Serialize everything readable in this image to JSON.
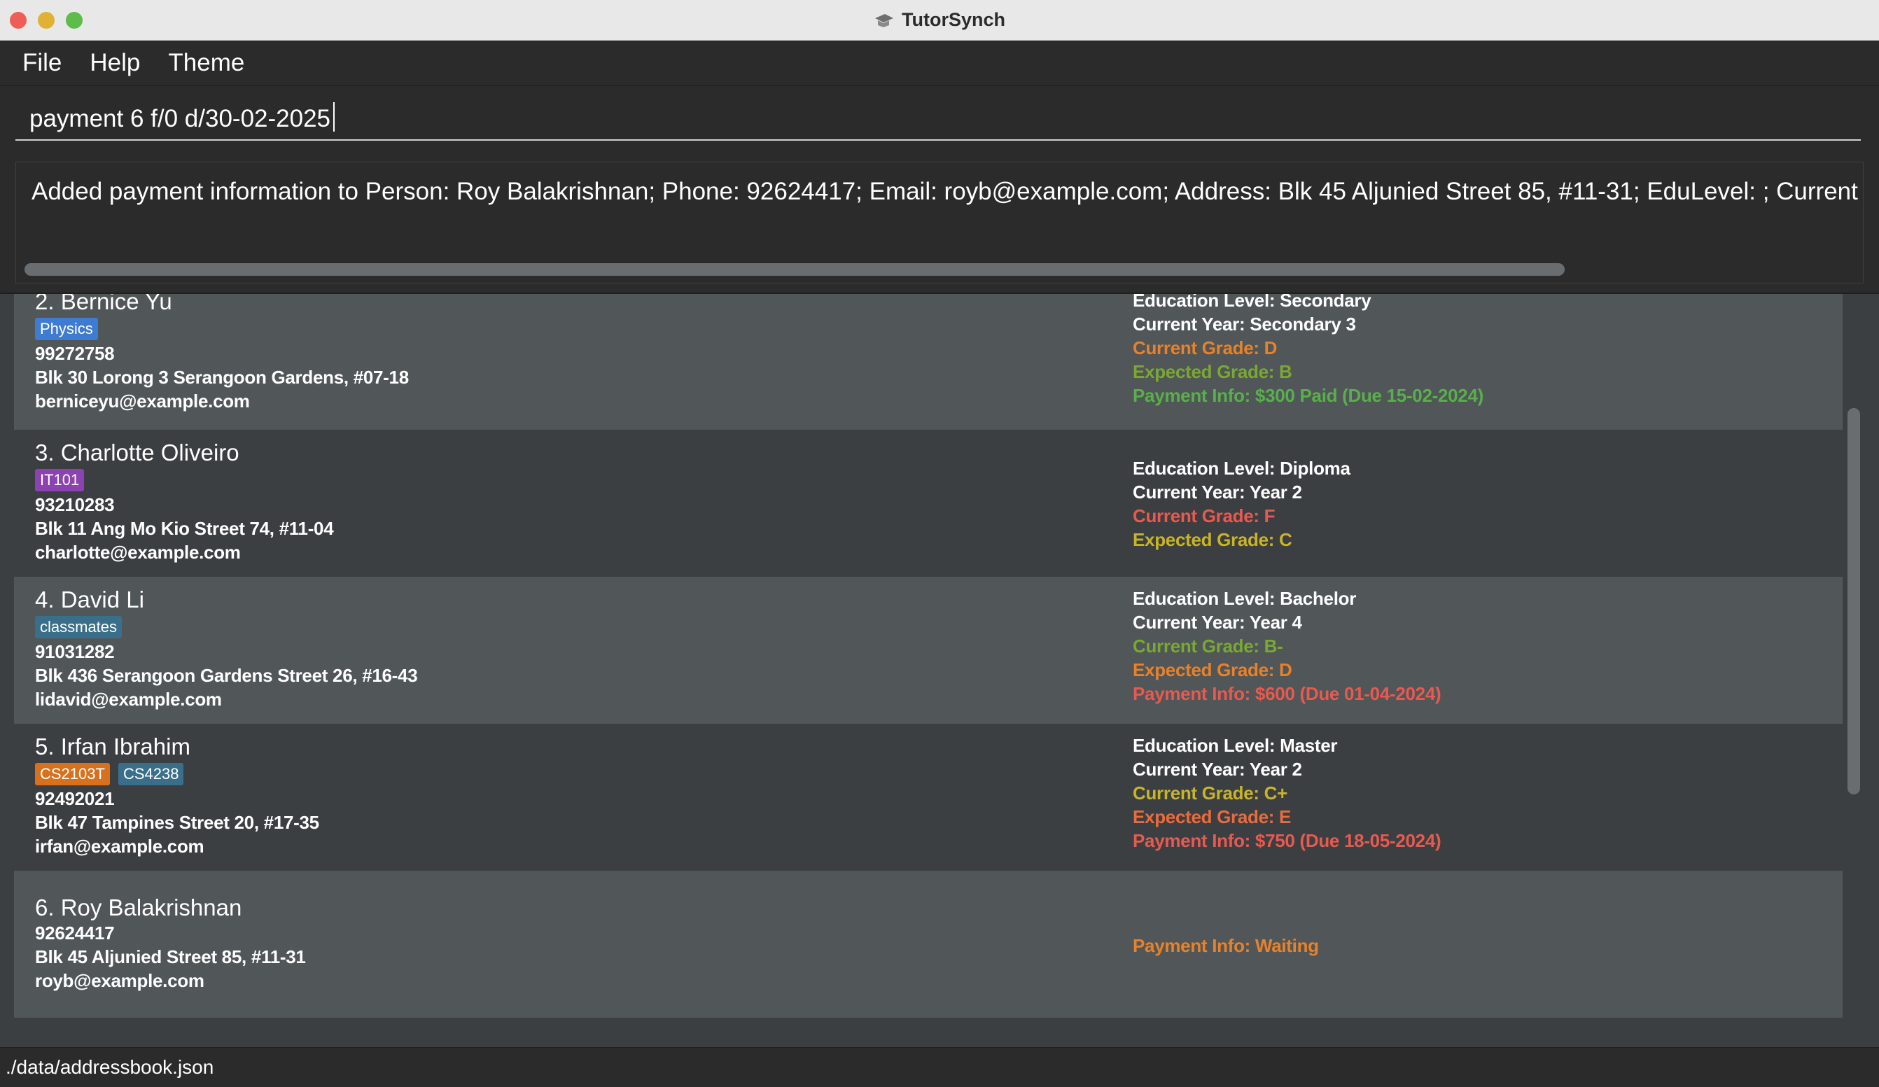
{
  "window": {
    "title": "TutorSynch"
  },
  "menu": {
    "items": [
      "File",
      "Help",
      "Theme"
    ]
  },
  "command": {
    "value": "payment 6 f/0 d/30-02-2025"
  },
  "result": {
    "text": "Added payment information to Person: Roy Balakrishnan; Phone: 92624417; Email: royb@example.com; Address: Blk 45 Aljunied Street 85, #11-31; EduLevel: ; Current Year: ; Current"
  },
  "persons": [
    {
      "name": "2. Bernice Yu",
      "tags": [
        {
          "label": "Physics",
          "color": "#3e7bd3"
        }
      ],
      "phone": "99272758",
      "address": "Blk 30 Lorong 3 Serangoon Gardens, #07-18",
      "email": "berniceyu@example.com",
      "education": "Education Level: Secondary",
      "year": "Current Year: Secondary 3",
      "current_grade": "Current Grade: D",
      "current_grade_color": "#e8822a",
      "expected_grade": "Expected Grade: B",
      "expected_grade_color": "#7aa832",
      "payment": "Payment Info: $300 Paid (Due 15-02-2024)",
      "payment_color": "#58b04a"
    },
    {
      "name": "3. Charlotte Oliveiro",
      "tags": [
        {
          "label": "IT101",
          "color": "#8c42b0"
        }
      ],
      "phone": "93210283",
      "address": "Blk 11 Ang Mo Kio Street 74, #11-04",
      "email": "charlotte@example.com",
      "education": "Education Level: Diploma",
      "year": "Current Year: Year 2",
      "current_grade": "Current Grade: F",
      "current_grade_color": "#e85a4f",
      "expected_grade": "Expected Grade: C",
      "expected_grade_color": "#c9b428",
      "payment": "",
      "payment_color": "#ffffff"
    },
    {
      "name": "4. David Li",
      "tags": [
        {
          "label": "classmates",
          "color": "#3a6f8c"
        }
      ],
      "phone": "91031282",
      "address": "Blk 436 Serangoon Gardens Street 26, #16-43",
      "email": "lidavid@example.com",
      "education": "Education Level: Bachelor",
      "year": "Current Year: Year 4",
      "current_grade": "Current Grade: B-",
      "current_grade_color": "#7aa832",
      "expected_grade": "Expected Grade: D",
      "expected_grade_color": "#e8822a",
      "payment": "Payment Info: $600 (Due 01-04-2024)",
      "payment_color": "#e85a4f"
    },
    {
      "name": "5. Irfan Ibrahim",
      "tags": [
        {
          "label": "CS2103T",
          "color": "#d8711e"
        },
        {
          "label": "CS4238",
          "color": "#3a6f8c"
        }
      ],
      "phone": "92492021",
      "address": "Blk 47 Tampines Street 20, #17-35",
      "email": "irfan@example.com",
      "education": "Education Level: Master",
      "year": "Current Year: Year 2",
      "current_grade": "Current Grade: C+",
      "current_grade_color": "#c9b428",
      "expected_grade": "Expected Grade: E",
      "expected_grade_color": "#ea6b3c",
      "payment": "Payment Info: $750 (Due 18-05-2024)",
      "payment_color": "#e85a4f"
    },
    {
      "name": "6. Roy Balakrishnan",
      "tags": [],
      "phone": "92624417",
      "address": "Blk 45 Aljunied Street 85, #11-31",
      "email": "royb@example.com",
      "payment": "Payment Info: Waiting",
      "payment_color": "#e8822a"
    }
  ],
  "status": {
    "path": "./data/addressbook.json"
  }
}
